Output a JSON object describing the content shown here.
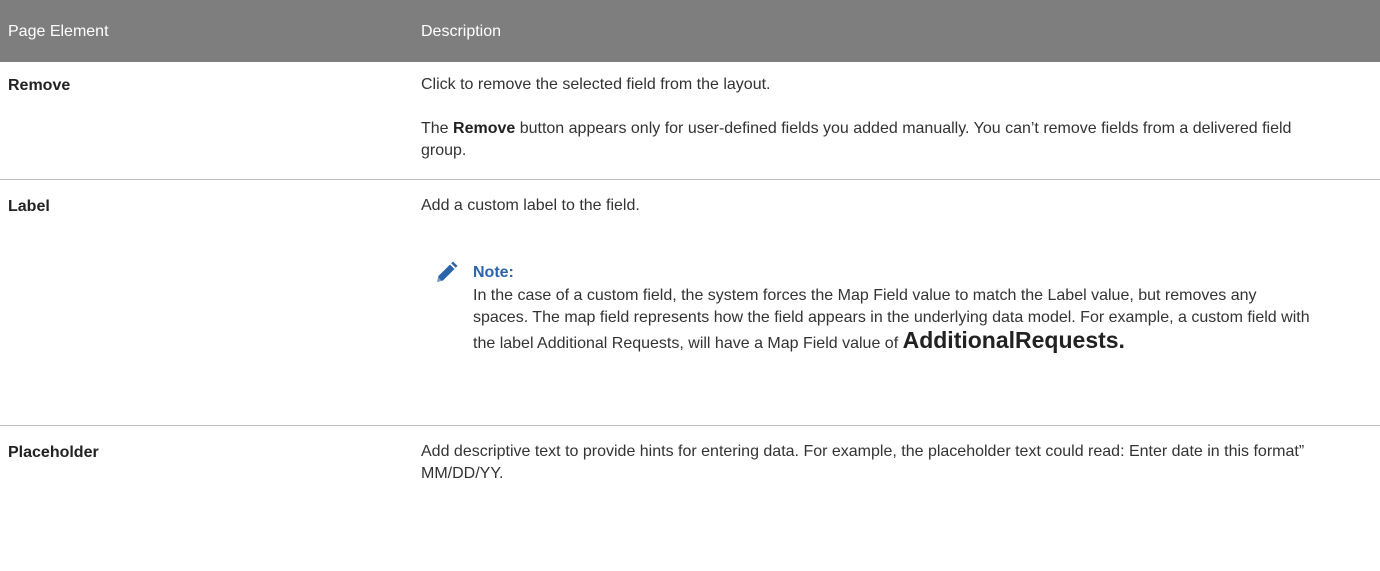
{
  "table": {
    "headers": {
      "col1": "Page Element",
      "col2": "Description"
    },
    "rows": {
      "remove": {
        "term": "Remove",
        "desc1": "Click to remove the selected field from the layout.",
        "desc2_pre": "The ",
        "desc2_bold": "Remove",
        "desc2_post": " button appears only for user-defined fields you added manually. You can’t remove fields from a delivered field group."
      },
      "label": {
        "term": "Label",
        "desc": "Add a custom label to the field.",
        "note": {
          "icon": "pencil-icon",
          "title": "Note:",
          "body": "In the case of a custom field, the system forces the Map Field value to match the Label value, but removes any spaces. The map field represents how the field appears in the underlying data model. For example, a custom field with the label Additional Requests, will have a Map Field value of ",
          "value": "AdditionalRequests."
        }
      },
      "placeholder": {
        "term": "Placeholder",
        "desc": "Add descriptive text to provide hints for entering data. For example, the placeholder text could read: Enter date in this format” MM/DD/YY."
      }
    }
  },
  "colors": {
    "header_bg": "#7e7e7e",
    "note_title": "#2b64a8",
    "divider": "#bdbdbd"
  }
}
